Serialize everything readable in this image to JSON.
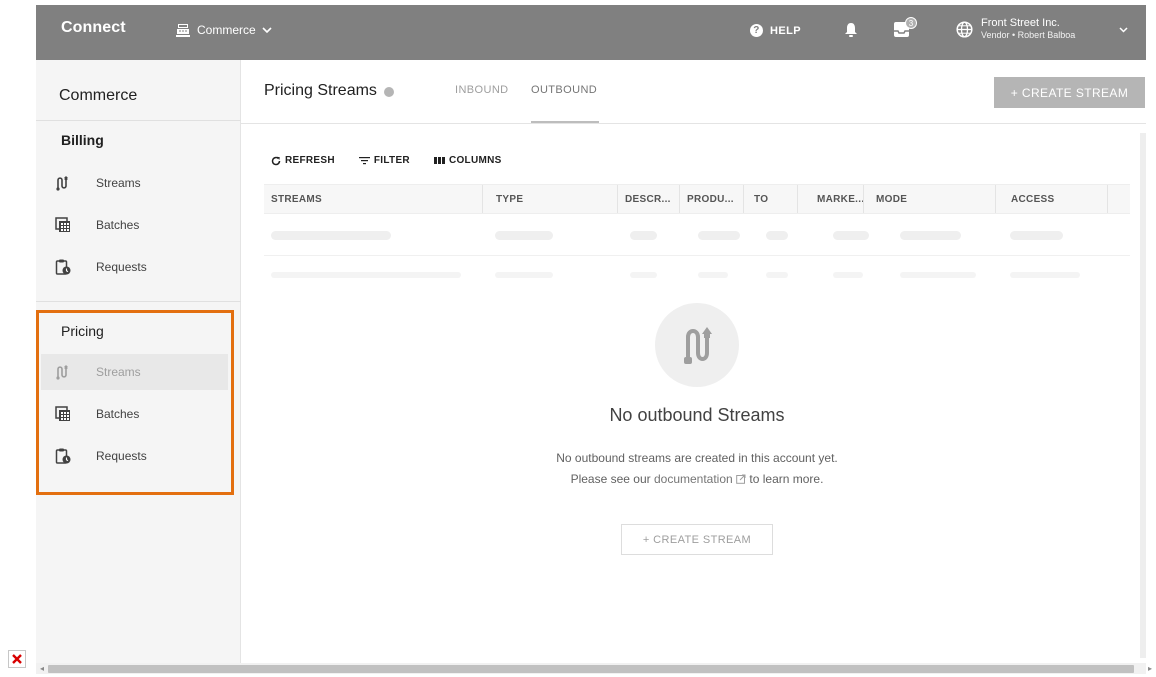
{
  "topbar": {
    "brand": "Connect",
    "module": "Commerce",
    "help": "HELP",
    "help_icon_glyph": "?",
    "notifications_count": "3",
    "account_name": "Front Street Inc.",
    "account_sub": "Vendor • Robert Balboa"
  },
  "sidebar": {
    "title": "Commerce",
    "groups": [
      {
        "label": "Billing",
        "items": [
          {
            "label": "Streams",
            "icon": "streams-icon"
          },
          {
            "label": "Batches",
            "icon": "batches-icon"
          },
          {
            "label": "Requests",
            "icon": "requests-icon"
          }
        ]
      },
      {
        "label": "Pricing",
        "items": [
          {
            "label": "Streams",
            "icon": "streams-icon",
            "active": true
          },
          {
            "label": "Batches",
            "icon": "batches-icon"
          },
          {
            "label": "Requests",
            "icon": "requests-icon"
          }
        ]
      }
    ],
    "highlight_color": "#e36f0f"
  },
  "header": {
    "title": "Pricing Streams",
    "tabs": [
      {
        "label": "INBOUND",
        "active": false
      },
      {
        "label": "OUTBOUND",
        "active": true
      }
    ],
    "create_button": "+ CREATE STREAM"
  },
  "toolbar": {
    "refresh": "REFRESH",
    "filter": "FILTER",
    "columns": "COLUMNS"
  },
  "table": {
    "columns": [
      "STREAMS",
      "TYPE",
      "DESCR...",
      "PRODU...",
      "TO",
      "MARKE...",
      "MODE",
      "ACCESS"
    ]
  },
  "empty_state": {
    "title": "No outbound Streams",
    "line1": "No outbound streams are created in this account yet.",
    "line2_prefix": "Please see our",
    "link_text": "documentation",
    "line2_suffix": "to learn more.",
    "button": "+ CREATE STREAM"
  },
  "colors": {
    "topbar": "#808080",
    "sidebar": "#f5f5f5",
    "accent_orange": "#e36f0f",
    "button_disabled": "#b5b5b5"
  }
}
